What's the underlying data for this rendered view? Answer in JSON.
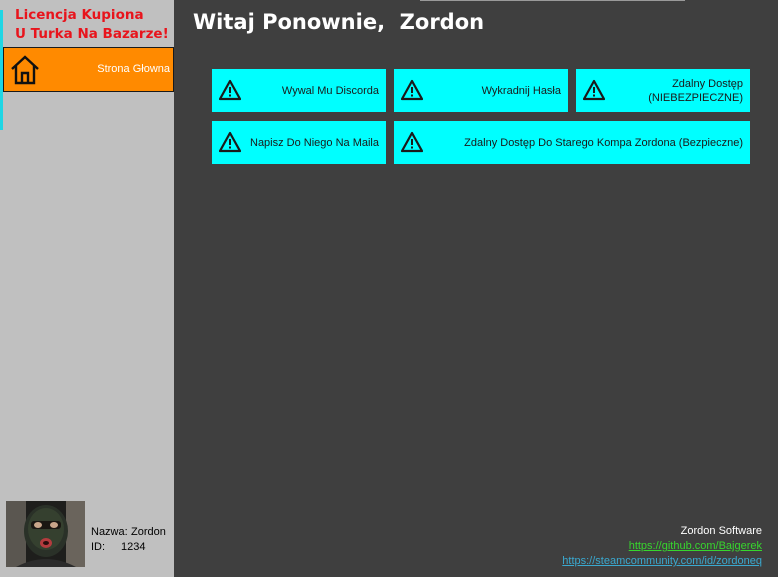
{
  "sidebar": {
    "license_line1": "Licencja Kupiona",
    "license_line2": "U Turka Na Bazarze!",
    "nav": [
      {
        "label": "Strona Głowna",
        "icon": "home-icon"
      }
    ],
    "user": {
      "name_label": "Nazwa:",
      "name_value": "Zordon",
      "id_label": "ID:",
      "id_value": "1234"
    }
  },
  "main": {
    "title": "Witaj Ponownie,  Zordon",
    "actions": [
      {
        "label": "Wywal Mu Discorda",
        "icon": "warning-icon"
      },
      {
        "label": "Wykradnij Hasła",
        "icon": "warning-icon"
      },
      {
        "label": "Zdalny Dostęp\n(NIEBEZPIECZNE)",
        "icon": "warning-icon"
      },
      {
        "label": "Napisz Do Niego Na Maila",
        "icon": "warning-icon"
      },
      {
        "label": "Zdalny Dostęp Do Starego Kompa Zordona (Bezpieczne)",
        "icon": "warning-icon"
      }
    ]
  },
  "footer": {
    "company": "Zordon Software",
    "github": "https://github.com/Bajgerek",
    "steam": "https://steamcommunity.com/id/zordoneq"
  },
  "colors": {
    "background": "#3f3f3f",
    "sidebar": "#c0c0c0",
    "accent": "#ff8a00",
    "button": "#00ffff",
    "license_text": "#e8141c"
  }
}
